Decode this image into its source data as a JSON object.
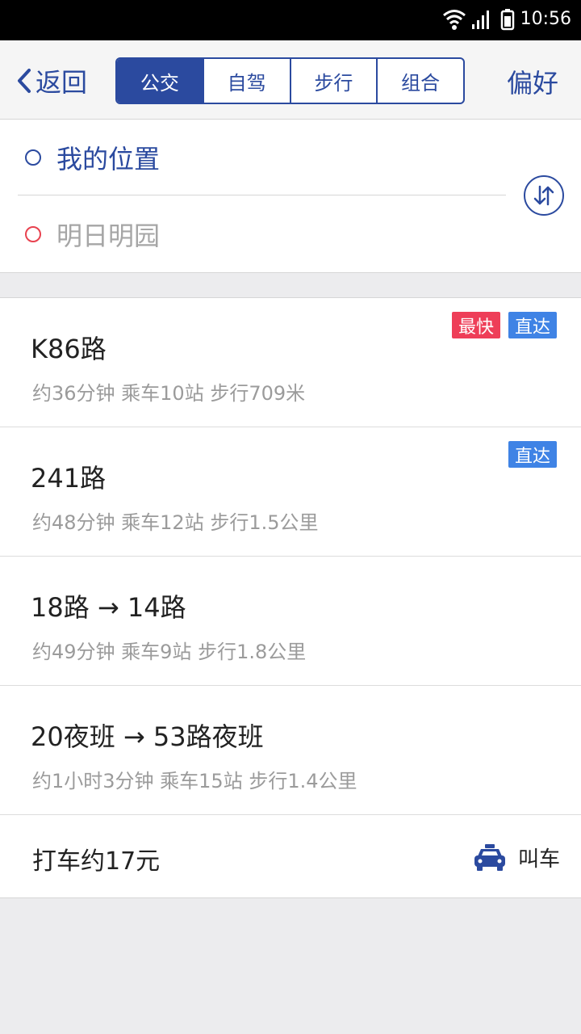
{
  "status": {
    "time": "10:56"
  },
  "header": {
    "back_label": "返回",
    "tabs": [
      {
        "label": "公交",
        "active": true
      },
      {
        "label": "自驾",
        "active": false
      },
      {
        "label": "步行",
        "active": false
      },
      {
        "label": "组合",
        "active": false
      }
    ],
    "preference_label": "偏好"
  },
  "od": {
    "origin": "我的位置",
    "destination": "明日明园"
  },
  "routes": [
    {
      "name": "K86路",
      "info": "约36分钟 乘车10站 步行709米",
      "badges": [
        "最快",
        "直达"
      ]
    },
    {
      "name": "241路",
      "info": "约48分钟 乘车12站 步行1.5公里",
      "badges": [
        "直达"
      ]
    },
    {
      "name": "18路 → 14路",
      "info": "约49分钟 乘车9站 步行1.8公里",
      "badges": []
    },
    {
      "name": "20夜班 → 53路夜班",
      "info": "约1小时3分钟 乘车15站 步行1.4公里",
      "badges": []
    }
  ],
  "taxi": {
    "estimate": "打车约17元",
    "call_label": "叫车"
  },
  "colors": {
    "accent": "#2b4a9f",
    "fast_badge": "#ee3e58",
    "direct_badge": "#3f83e5"
  },
  "icons": [
    "wifi-icon",
    "signal-icon",
    "battery-icon",
    "chevron-left-icon",
    "swap-icon",
    "taxi-icon"
  ]
}
